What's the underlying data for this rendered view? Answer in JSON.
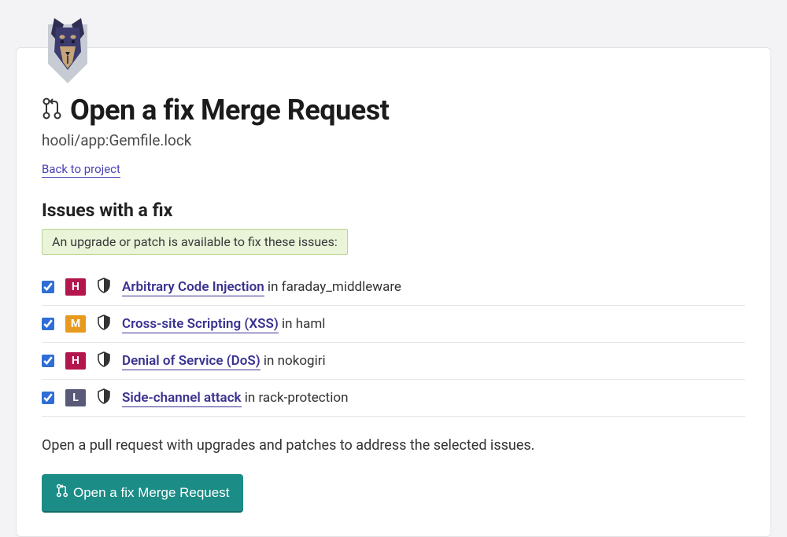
{
  "header": {
    "title": "Open a fix Merge Request",
    "subtitle": "hooli/app:Gemfile.lock",
    "back_link": "Back to project"
  },
  "section": {
    "title": "Issues with a fix",
    "notice": "An upgrade or patch is available to fix these issues:"
  },
  "issues": [
    {
      "severity": "H",
      "vuln": "Arbitrary Code Injection",
      "in": " in faraday_middleware"
    },
    {
      "severity": "M",
      "vuln": "Cross-site Scripting (XSS)",
      "in": " in haml"
    },
    {
      "severity": "H",
      "vuln": "Denial of Service (DoS)",
      "in": " in nokogiri"
    },
    {
      "severity": "L",
      "vuln": "Side-channel attack",
      "in": " in rack-protection"
    }
  ],
  "description": "Open a pull request with upgrades and patches to address the selected issues.",
  "cta_label": "Open a fix Merge Request",
  "colors": {
    "H": "#b3154d",
    "M": "#e79a1f",
    "L": "#5a5a78"
  }
}
